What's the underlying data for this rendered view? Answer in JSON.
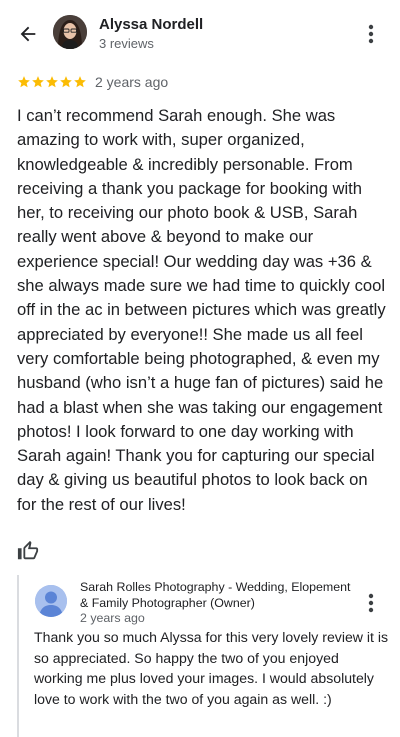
{
  "header": {
    "reviewer_name": "Alyssa Nordell",
    "reviewer_meta": "3 reviews",
    "back_icon": "arrow-back-icon",
    "more_icon": "more-vert-icon"
  },
  "review": {
    "rating": 5,
    "rating_max": 5,
    "star_color": "#fbbc04",
    "date": "2 years ago",
    "text": "I can’t recommend Sarah enough. She was amazing to work with, super organized, knowledgeable & incredibly personable. From receiving a thank you package for booking with her, to receiving our photo book & USB, Sarah really went above & beyond to make our experience special! Our wedding day was +36 & she always made sure we had time to quickly cool off in the ac in between pictures which was greatly appreciated by everyone!! She made us all feel very comfortable being photographed, & even my husband (who isn’t a huge fan of pictures) said he had a blast when she was taking our engagement photos! I look forward to one day working with Sarah again! Thank you for capturing our special day & giving us beautiful photos to look back on for the rest of our lives!",
    "like_icon": "thumbs-up-icon"
  },
  "owner_reply": {
    "name": "Sarah Rolles Photography - Wedding, Elopement & Family Photographer (Owner)",
    "date": "2 years ago",
    "text": "Thank you so much Alyssa for this very lovely review it is so appreciated. So happy the two of you enjoyed working me plus loved your images. I would absolutely love to work with the two of you again as well. :)",
    "avatar_icon": "person-icon",
    "more_icon": "more-vert-icon"
  }
}
